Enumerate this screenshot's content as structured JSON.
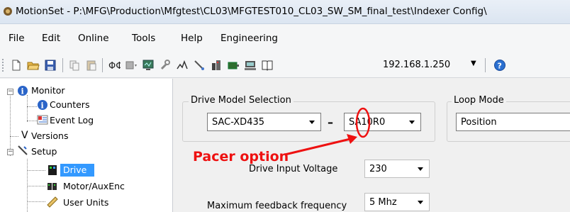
{
  "window": {
    "title": "MotionSet - P:\\MFG\\Production\\Mfgtest\\CL03\\MFGTEST010_CL03_SW_SM_final_test\\Indexer Config\\"
  },
  "menu": {
    "items": [
      "File",
      "Edit",
      "Online",
      "Tools",
      "Help",
      "Engineering"
    ]
  },
  "toolbar": {
    "icons": [
      "new-file-icon",
      "open-folder-icon",
      "save-icon",
      "copy-icon",
      "paste-icon",
      "connect-icon",
      "drive-icon",
      "monitor-icon",
      "tools-icon",
      "scope-icon",
      "probe-icon",
      "io-icon",
      "motor-icon",
      "network-icon",
      "book-icon"
    ],
    "ip_address": "192.168.1.250",
    "help_icon": "help-icon"
  },
  "tree": {
    "items": [
      {
        "label": "Monitor",
        "icon": "info-icon",
        "expander": "−"
      },
      {
        "label": "Counters",
        "icon": "info-icon"
      },
      {
        "label": "Event Log",
        "icon": "event-log-icon"
      },
      {
        "label": "Versions",
        "icon": "versions-icon"
      },
      {
        "label": "Setup",
        "icon": "setup-icon",
        "expander": "−"
      },
      {
        "label": "Drive",
        "icon": "drive-icon",
        "selected": true
      },
      {
        "label": "Motor/AuxEnc",
        "icon": "motor-icon"
      },
      {
        "label": "User Units",
        "icon": "ruler-icon"
      }
    ],
    "versions_glyph": "V"
  },
  "content": {
    "drive_model": {
      "title": "Drive Model Selection",
      "model": "SAC-XD435",
      "separator": "–",
      "option": "SA10R0"
    },
    "loop_mode": {
      "title": "Loop Mode",
      "value": "Position"
    },
    "input_voltage": {
      "label": "Drive Input Voltage",
      "value": "230"
    },
    "feedback_freq": {
      "label": "Maximum feedback frequency",
      "value": "5 Mhz"
    }
  },
  "annotation": {
    "text": "Pacer option",
    "color": "#ee1111"
  },
  "colors": {
    "selection": "#3399ff",
    "annotation": "#ee1111"
  }
}
